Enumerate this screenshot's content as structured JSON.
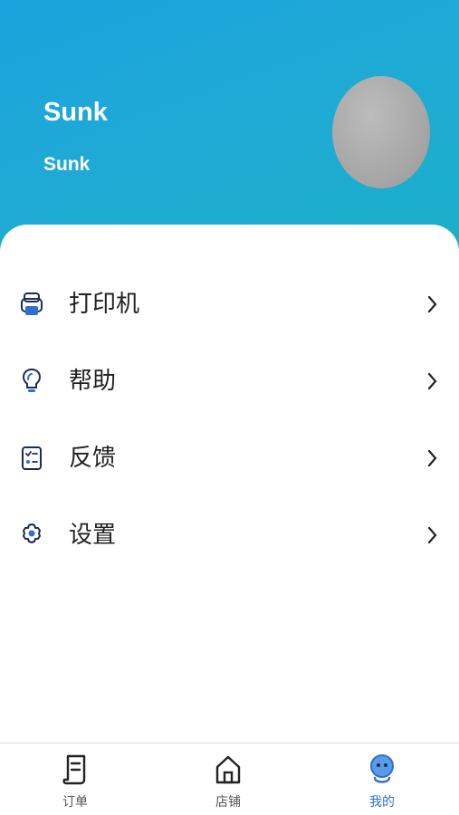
{
  "profile": {
    "name": "Sunk",
    "subtitle": "Sunk"
  },
  "menu": {
    "items": [
      {
        "label": "打印机",
        "icon": "printer-icon"
      },
      {
        "label": "帮助",
        "icon": "lightbulb-icon"
      },
      {
        "label": "反馈",
        "icon": "feedback-checklist-icon"
      },
      {
        "label": "设置",
        "icon": "gear-icon"
      }
    ]
  },
  "tabbar": {
    "tabs": [
      {
        "label": "订单",
        "icon": "orders-icon"
      },
      {
        "label": "店铺",
        "icon": "store-icon"
      },
      {
        "label": "我的",
        "icon": "profile-icon"
      }
    ],
    "active": "我的"
  },
  "colors": {
    "header_gradient_start": "#1aa3dd",
    "header_gradient_end": "#1bb0c8",
    "accent": "#2f6fd0",
    "text": "#222222"
  }
}
